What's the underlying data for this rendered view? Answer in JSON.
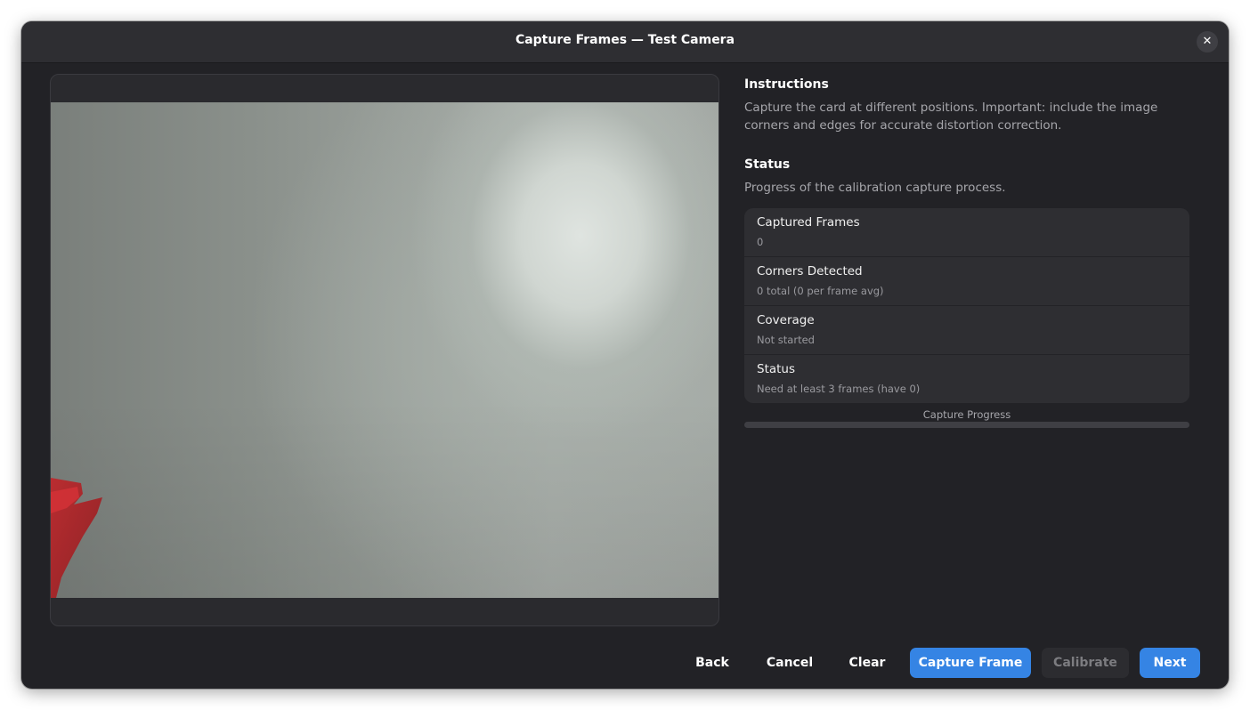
{
  "window": {
    "title": "Capture Frames — Test Camera",
    "close_glyph": "✕"
  },
  "instructions": {
    "heading": "Instructions",
    "text": "Capture the card at different positions. Important: include the image corners and edges for accurate distortion correction."
  },
  "status": {
    "heading": "Status",
    "description": "Progress of the calibration capture process.",
    "rows": [
      {
        "title": "Captured Frames",
        "value": "0"
      },
      {
        "title": "Corners Detected",
        "value": "0 total (0 per frame avg)"
      },
      {
        "title": "Coverage",
        "value": "Not started"
      },
      {
        "title": "Status",
        "value": "Need at least 3 frames (have 0)"
      }
    ]
  },
  "progress": {
    "label": "Capture Progress",
    "fraction": 0
  },
  "buttons": {
    "back": "Back",
    "cancel": "Cancel",
    "clear": "Clear",
    "capture": "Capture Frame",
    "calibrate": "Calibrate",
    "next": "Next"
  },
  "colors": {
    "accent": "#3584e4",
    "dialog_bg": "#222226",
    "card_bg": "#2e2e32"
  },
  "icons": {
    "close": "close-icon"
  }
}
